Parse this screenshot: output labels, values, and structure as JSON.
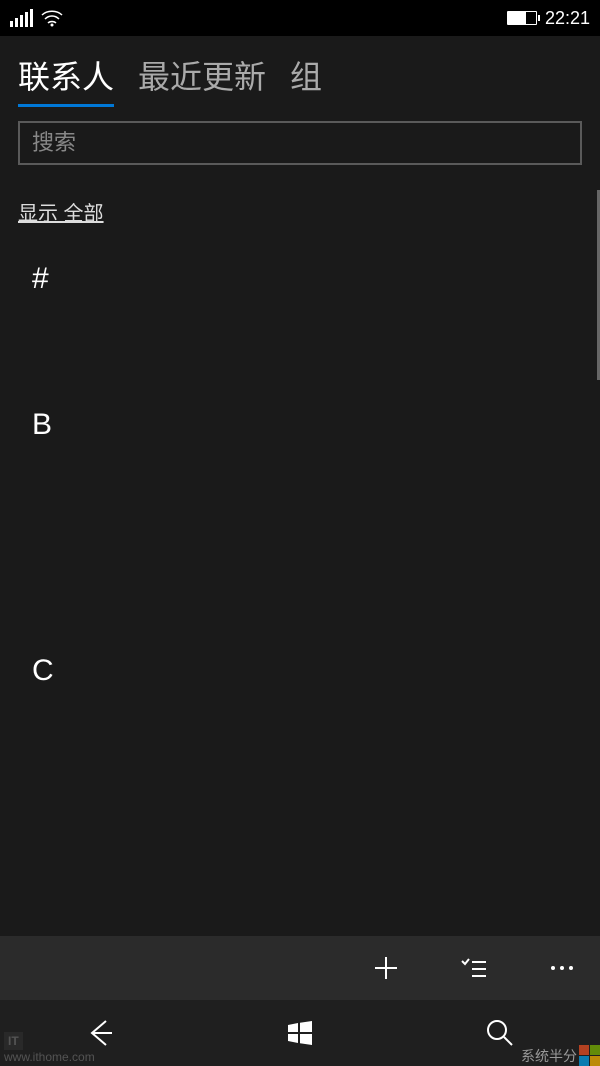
{
  "statusBar": {
    "time": "22:21"
  },
  "tabs": {
    "contacts": "联系人",
    "recent": "最近更新",
    "groups": "组"
  },
  "search": {
    "placeholder": "搜索"
  },
  "filter": {
    "label": "显示 全部"
  },
  "sections": [
    {
      "letter": "#"
    },
    {
      "letter": "B"
    },
    {
      "letter": "C"
    }
  ],
  "watermarks": {
    "left": "www.ithome.com",
    "right": "系统半分"
  }
}
